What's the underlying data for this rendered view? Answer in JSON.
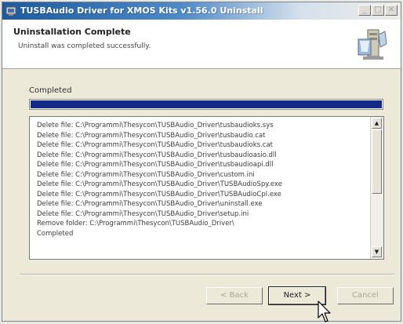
{
  "window": {
    "title": "TUSBAudio Driver for XMOS Kits v1.56.0 Uninstall",
    "controls": [
      "_",
      "□",
      "✕"
    ]
  },
  "header": {
    "title": "Uninstallation Complete",
    "subtitle": "Uninstall was completed successfully.",
    "image_icon": "installer-computer-icon"
  },
  "progress": {
    "label": "Completed",
    "fraction": 1.0,
    "color": "#142b86"
  },
  "log": {
    "lines": [
      "Delete file: C:\\Programmi\\Thesycon\\TUSBAudio_Driver\\tusbaudioks.sys",
      "Delete file: C:\\Programmi\\Thesycon\\TUSBAudio_Driver\\tusbaudio.cat",
      "Delete file: C:\\Programmi\\Thesycon\\TUSBAudio_Driver\\tusbaudioks.cat",
      "Delete file: C:\\Programmi\\Thesycon\\TUSBAudio_Driver\\tusbaudioasio.dll",
      "Delete file: C:\\Programmi\\Thesycon\\TUSBAudio_Driver\\tusbaudioapi.dll",
      "Delete file: C:\\Programmi\\Thesycon\\TUSBAudio_Driver\\custom.ini",
      "Delete file: C:\\Programmi\\Thesycon\\TUSBAudio_Driver\\TUSBAudioSpy.exe",
      "Delete file: C:\\Programmi\\Thesycon\\TUSBAudio_Driver\\TUSBAudioCpl.exe",
      "Delete file: C:\\Programmi\\Thesycon\\TUSBAudio_Driver\\uninstall.exe",
      "Delete file: C:\\Programmi\\Thesycon\\TUSBAudio_Driver\\setup.ini",
      "Remove folder: C:\\Programmi\\Thesycon\\TUSBAudio_Driver\\",
      "Completed"
    ]
  },
  "buttons": {
    "back": "< Back",
    "next": "Next >",
    "cancel": "Cancel"
  }
}
